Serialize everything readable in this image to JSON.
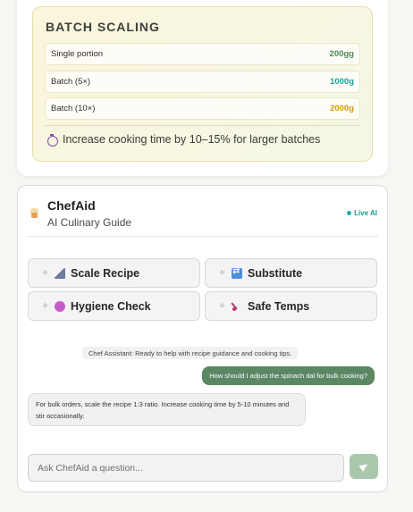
{
  "batch": {
    "title": "BATCH SCALING",
    "rows": [
      {
        "label": "Single portion",
        "value": "200gg",
        "color": "#4e8a55"
      },
      {
        "label": "Batch (5×)",
        "value": "1000g",
        "color": "#1aa39a"
      },
      {
        "label": "Batch (10×)",
        "value": "2000g",
        "color": "#d99a1a"
      }
    ],
    "note": "Increase cooking time by 10–15% for larger batches",
    "note_icon": "timer-icon"
  },
  "chat": {
    "title": "ChefAid",
    "subtitle": "AI Culinary Guide",
    "live_label": "Live AI",
    "actions": [
      {
        "label": "Scale Recipe",
        "icon": "ruler-icon"
      },
      {
        "label": "Substitute",
        "icon": "swap-icon"
      },
      {
        "label": "Hygiene Check",
        "icon": "soap-icon"
      },
      {
        "label": "Safe Temps",
        "icon": "thermometer-icon"
      }
    ],
    "system_message": "Chef Assistant: Ready to help with recipe guidance and cooking tips.",
    "user_message": "How should I adjust the spinach dal for bulk cooking?",
    "bot_message": "For bulk orders, scale the recipe 1:3 ratio. Increase cooking time by 5-10 minutes and stir occasionally.",
    "input_placeholder": "Ask ChefAid a question...",
    "accent": "#5b8763"
  }
}
